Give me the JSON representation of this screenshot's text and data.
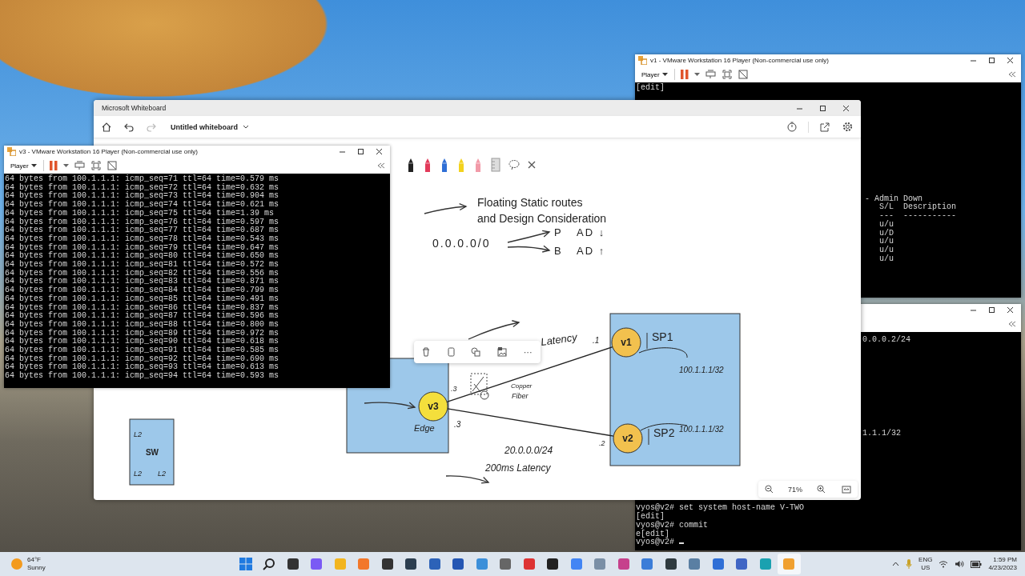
{
  "vm_v1": {
    "kind": "status",
    "title": "v1 - VMware Workstation 16 Player (Non-commercial use only)",
    "menu": "Player",
    "lines": [
      "[edit]"
    ],
    "side_lines": [
      "- Admin Down",
      "S/L  Description",
      "---  -----------",
      "u/u",
      "u/D",
      "u/u",
      "u/u",
      "u/u"
    ]
  },
  "vm_v2": {
    "kind": "config",
    "side_lines": [
      "0.0.0.2/24",
      "1.1.1/32"
    ],
    "lines": [
      "vyos@v2# set system host-name V-TWO",
      "[edit]",
      "vyos@v2# commit",
      "e[edit]",
      "vyos@v2#"
    ]
  },
  "whiteboard": {
    "title": "Microsoft Whiteboard",
    "board_name": "Untitled whiteboard",
    "toolbar_buttons": [
      {
        "kind": "undo",
        "disabled": false
      },
      {
        "kind": "redo",
        "disabled": true
      }
    ],
    "zoom": "71%",
    "canvas": {
      "heading": [
        "Floating Static routes",
        "and Design Consideration"
      ],
      "route": "0.0.0.0/0",
      "paths": [
        {
          "name": "P",
          "ad": "AD ↓"
        },
        {
          "name": "B",
          "ad": "AD ↑"
        }
      ],
      "nodes": [
        {
          "label": "v1",
          "tag": "SP1",
          "color": "#f2c14e"
        },
        {
          "label": "v2",
          "tag": "SP2",
          "color": "#f2c14e"
        },
        {
          "label": "v3",
          "tag": "Edge",
          "color": "#f4df3c"
        }
      ],
      "notes": [
        "Latency",
        ".1",
        ".3",
        ".3",
        ".2",
        "Copper",
        "Fiber",
        "20.0.0.0/24",
        "200ms Latency",
        "100.1.1.1/32",
        "100.1.1.1/32"
      ],
      "switch": {
        "label": "SW",
        "ports": [
          "L2",
          "L2",
          "L2"
        ]
      },
      "selection_more": "···"
    }
  },
  "vm_v3": {
    "kind": "ping",
    "title": "v3 - VMware Workstation 16 Player (Non-commercial use only)",
    "menu": "Player",
    "lines": [
      "64 bytes from 100.1.1.1: icmp_seq=71 ttl=64 time=0.579 ms",
      "64 bytes from 100.1.1.1: icmp_seq=72 ttl=64 time=0.632 ms",
      "64 bytes from 100.1.1.1: icmp_seq=73 ttl=64 time=0.904 ms",
      "64 bytes from 100.1.1.1: icmp_seq=74 ttl=64 time=0.621 ms",
      "64 bytes from 100.1.1.1: icmp_seq=75 ttl=64 time=1.39 ms",
      "64 bytes from 100.1.1.1: icmp_seq=76 ttl=64 time=0.597 ms",
      "64 bytes from 100.1.1.1: icmp_seq=77 ttl=64 time=0.687 ms",
      "64 bytes from 100.1.1.1: icmp_seq=78 ttl=64 time=0.543 ms",
      "64 bytes from 100.1.1.1: icmp_seq=79 ttl=64 time=0.647 ms",
      "64 bytes from 100.1.1.1: icmp_seq=80 ttl=64 time=0.650 ms",
      "64 bytes from 100.1.1.1: icmp_seq=81 ttl=64 time=0.572 ms",
      "64 bytes from 100.1.1.1: icmp_seq=82 ttl=64 time=0.556 ms",
      "64 bytes from 100.1.1.1: icmp_seq=83 ttl=64 time=0.871 ms",
      "64 bytes from 100.1.1.1: icmp_seq=84 ttl=64 time=0.799 ms",
      "64 bytes from 100.1.1.1: icmp_seq=85 ttl=64 time=0.491 ms",
      "64 bytes from 100.1.1.1: icmp_seq=86 ttl=64 time=0.837 ms",
      "64 bytes from 100.1.1.1: icmp_seq=87 ttl=64 time=0.596 ms",
      "64 bytes from 100.1.1.1: icmp_seq=88 ttl=64 time=0.800 ms",
      "64 bytes from 100.1.1.1: icmp_seq=89 ttl=64 time=0.972 ms",
      "64 bytes from 100.1.1.1: icmp_seq=90 ttl=64 time=0.618 ms",
      "64 bytes from 100.1.1.1: icmp_seq=91 ttl=64 time=0.585 ms",
      "64 bytes from 100.1.1.1: icmp_seq=92 ttl=64 time=0.690 ms",
      "64 bytes from 100.1.1.1: icmp_seq=93 ttl=64 time=0.613 ms",
      "64 bytes from 100.1.1.1: icmp_seq=94 ttl=64 time=0.593 ms"
    ]
  },
  "taskbar": {
    "temperature": "64°F",
    "weather": "Sunny",
    "language": "ENG",
    "region": "US",
    "time": "1:59 PM",
    "date": "4/23/2023"
  }
}
